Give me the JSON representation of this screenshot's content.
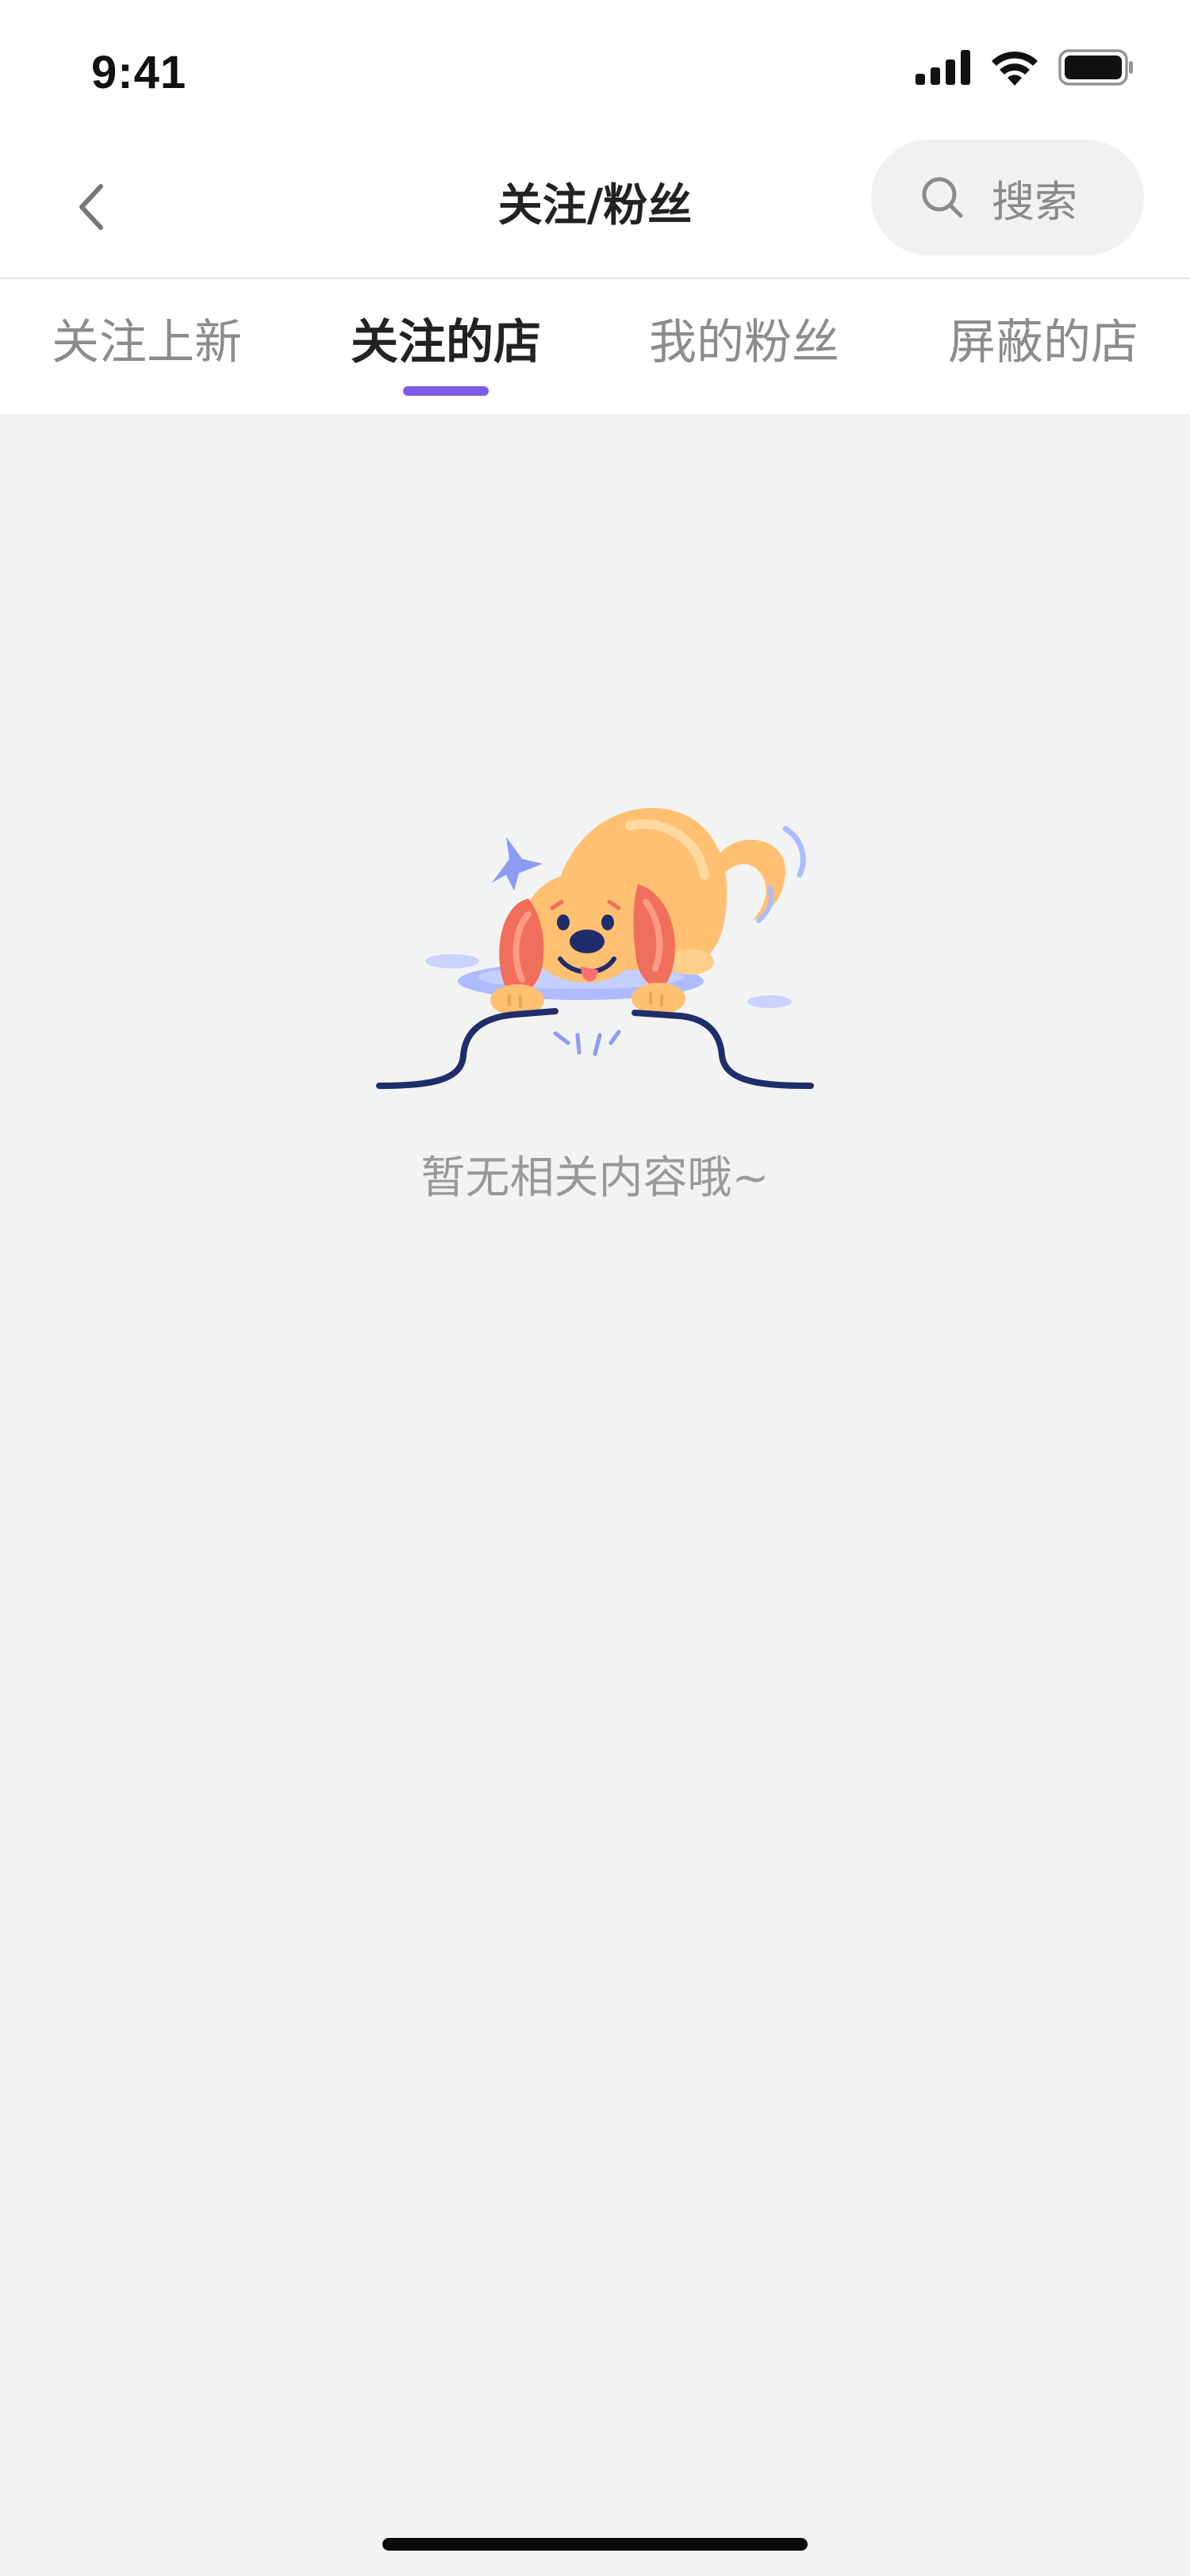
{
  "status_bar": {
    "time": "9:41"
  },
  "header": {
    "title": "关注/粉丝",
    "back_icon": "chevron-left-icon",
    "search_label": "搜索",
    "search_icon": "search-icon"
  },
  "tabs": [
    {
      "label": "关注上新",
      "active": false
    },
    {
      "label": "关注的店",
      "active": true
    },
    {
      "label": "我的粉丝",
      "active": false
    },
    {
      "label": "屏蔽的店",
      "active": false
    }
  ],
  "empty_state": {
    "illustration": "dog-digging-illustration",
    "message": "暂无相关内容哦~"
  },
  "colors": {
    "accent": "#7b5be6",
    "background": "#f2f3f3",
    "dog_body": "#ffc072",
    "dog_ear": "#f06f5c",
    "cable": "#1f2d6b"
  }
}
